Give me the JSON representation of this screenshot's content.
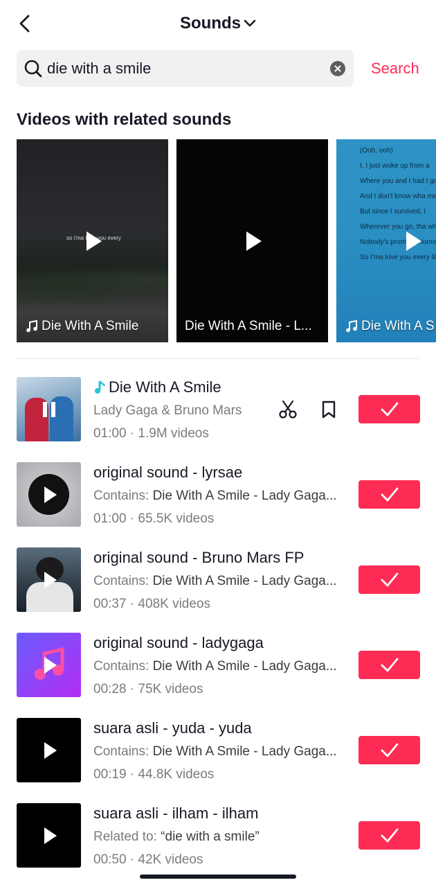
{
  "header": {
    "title": "Sounds"
  },
  "search": {
    "query": "die with a smile",
    "action_label": "Search"
  },
  "section": {
    "title": "Videos with related sounds"
  },
  "videos": [
    {
      "caption": "Die With A Smile",
      "has_music_icon": true,
      "overlay_text": "so i'ma love you every"
    },
    {
      "caption": "Die With A Smile - L...",
      "has_music_icon": false
    },
    {
      "caption": "Die With A S",
      "has_music_icon": true,
      "lyrics": [
        "(Ooh, ooh)",
        "I, I just woke up from a",
        "Where you and I had t goodbye",
        "And I don't know wha means",
        "But since I survived, I",
        "Wherever you go, tha where I'll follow",
        "Nobody's promised tomorrow",
        "So I'ma love you every like it's the last night"
      ]
    }
  ],
  "sounds": [
    {
      "title": "Die With A Smile",
      "subtitle_prefix": "",
      "subtitle": "Lady Gaga & Bruno Mars",
      "meta": "01:00 · 1.9M videos",
      "playing": true,
      "thumb": "album-art"
    },
    {
      "title": "original sound - lyrsae",
      "subtitle_prefix": "Contains:",
      "subtitle": "Die With A Smile - Lady Gaga...",
      "meta": "01:00 · 65.5K videos",
      "playing": false,
      "thumb": "vinyl"
    },
    {
      "title": "original sound - Bruno Mars FP",
      "subtitle_prefix": "Contains:",
      "subtitle": "Die With A Smile - Lady Gaga...",
      "meta": "00:37 · 408K videos",
      "playing": false,
      "thumb": "photo"
    },
    {
      "title": "original sound - ladygaga",
      "subtitle_prefix": "Contains:",
      "subtitle": "Die With A Smile - Lady Gaga...",
      "meta": "00:28 · 75K videos",
      "playing": false,
      "thumb": "music-note"
    },
    {
      "title": "suara asli - yuda - yuda",
      "subtitle_prefix": "Contains:",
      "subtitle": "Die With A Smile - Lady Gaga...",
      "meta": "00:19 · 44.8K videos",
      "playing": false,
      "thumb": "black"
    },
    {
      "title": "suara asli - ilham - ilham",
      "subtitle_prefix": "Related to:",
      "subtitle": "“die with a smile”",
      "meta": "00:50 · 42K videos",
      "playing": false,
      "thumb": "black"
    }
  ],
  "colors": {
    "accent": "#fe2c55",
    "text": "#161823",
    "secondary": "#7a7b80",
    "search_bg": "#f1f1f2"
  },
  "icons": {
    "back": "chevron-left-icon",
    "dropdown": "chevron-down-icon",
    "search": "search-icon",
    "clear": "clear-icon",
    "play": "play-icon",
    "pause": "pause-icon",
    "music": "music-note-icon",
    "cut": "scissors-icon",
    "favorite": "bookmark-icon",
    "check": "check-icon"
  }
}
